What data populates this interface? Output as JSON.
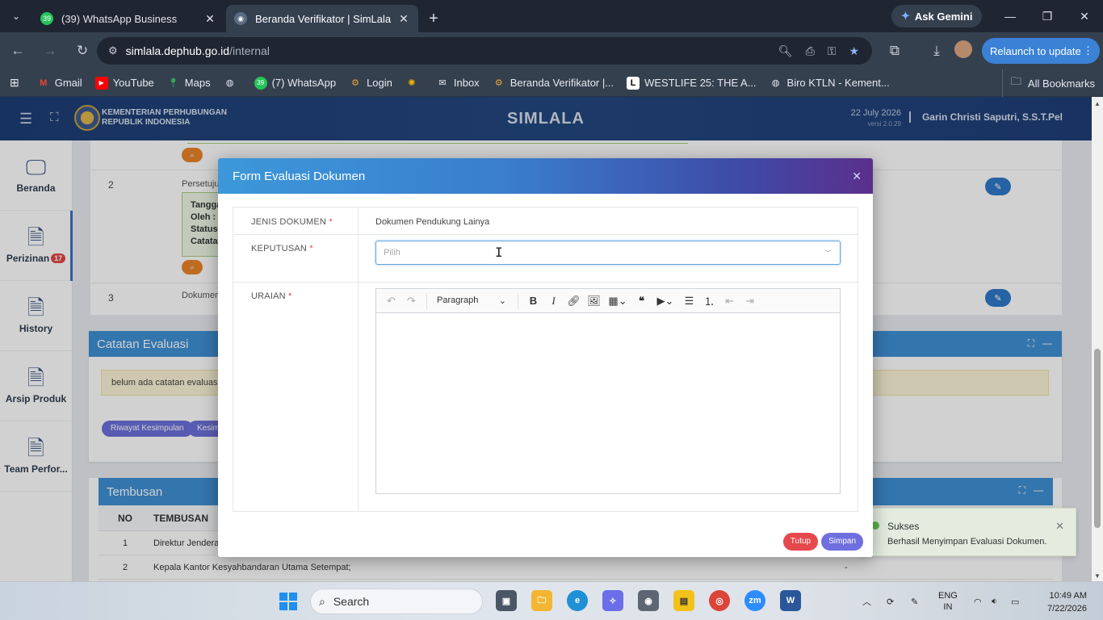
{
  "browser": {
    "tabs": [
      {
        "badge": "39",
        "title": "(39) WhatsApp Business",
        "active": false
      },
      {
        "title": "Beranda Verifikator | SimLala",
        "active": true
      }
    ],
    "ask_gemini": "Ask Gemini",
    "url_domain": "simlala.dephub.go.id",
    "url_path": "/internal",
    "relaunch": "Relaunch to update",
    "bookmarks": [
      "Gmail",
      "YouTube",
      "Maps",
      "(7) WhatsApp",
      "Login",
      "Inbox",
      "Beranda Verifikator |...",
      "WESTLIFE 25: THE A...",
      "Biro KTLN - Kement..."
    ],
    "all_bookmarks": "All Bookmarks"
  },
  "header": {
    "ministry_line1": "KEMENTERIAN PERHUBUNGAN",
    "ministry_line2": "REPUBLIK INDONESIA",
    "app_title": "SIMLALA",
    "date": "22 July 2026",
    "version": "versi 2.0.29",
    "user": "Garin Christi Saputri, S.S.T.Pel"
  },
  "sidebar": {
    "items": [
      {
        "label": "Beranda"
      },
      {
        "label": "Perizinan",
        "badge": "17"
      },
      {
        "label": "History"
      },
      {
        "label": "Arsip Produk"
      },
      {
        "label": "Team Perfor..."
      }
    ]
  },
  "background": {
    "row2_num": "2",
    "row2_title": "Persetujua",
    "row2_box": [
      "Tangga",
      "Oleh :",
      "Status",
      "Catatan"
    ],
    "row3_num": "3",
    "row3_title": "Dokumen",
    "catatan_title": "Catatan Evaluasi",
    "catatan_empty": "belum ada catatan evaluasi",
    "pill_riwayat": "Riwayat Kesimpulan",
    "pill_kesim": "Kesim",
    "tembusan_title": "Tembusan",
    "tembusan_headers": [
      "NO",
      "TEMBUSAN"
    ],
    "tembusan_rows": [
      {
        "no": "1",
        "text": "Direktur Jenderal"
      },
      {
        "no": "2",
        "text": "Kepala Kantor Kesyahbandaran Utama Setempat;",
        "extra": "-"
      }
    ]
  },
  "toast": {
    "title": "Sukses",
    "message": "Berhasil Menyimpan Evaluasi Dokumen."
  },
  "modal": {
    "title": "Form Evaluasi Dokumen",
    "jenis_label": "JENIS DOKUMEN",
    "jenis_value": "Dokumen Pendukung Lainya",
    "keputusan_label": "KEPUTUSAN",
    "keputusan_placeholder": "Pilih",
    "uraian_label": "URAIAN",
    "editor_format": "Paragraph",
    "btn_close": "Tutup",
    "btn_save": "Simpan"
  },
  "taskbar": {
    "search_placeholder": "Search",
    "lang_line1": "ENG",
    "lang_line2": "IN",
    "time": "10:49 AM",
    "date": "7/22/2026"
  }
}
